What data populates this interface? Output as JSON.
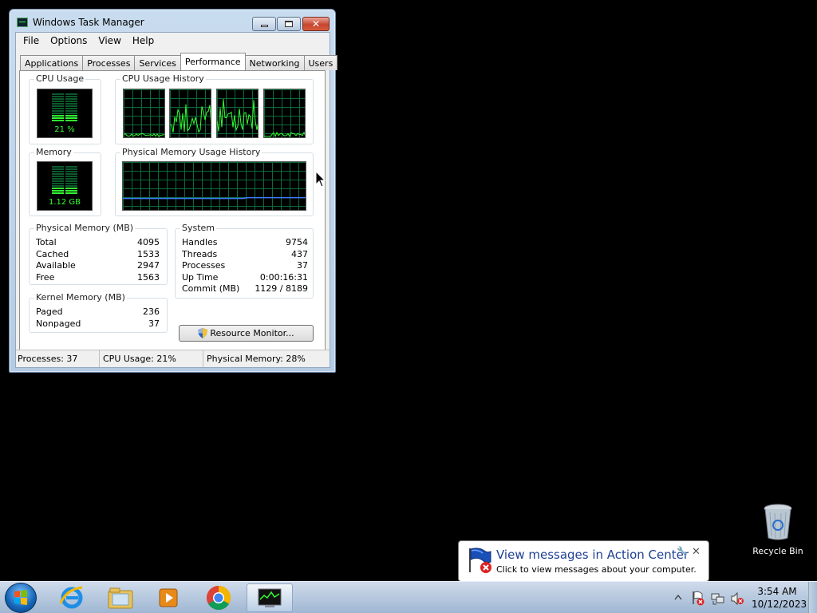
{
  "window": {
    "title": "Windows Task Manager",
    "controls": {
      "minimize": "minimize",
      "maximize": "maximize",
      "close": "✕"
    }
  },
  "menu": [
    "File",
    "Options",
    "View",
    "Help"
  ],
  "tabs": [
    "Applications",
    "Processes",
    "Services",
    "Performance",
    "Networking",
    "Users"
  ],
  "active_tab": "Performance",
  "performance": {
    "cpu_usage": {
      "label": "CPU Usage",
      "value": "21 %",
      "percent": 21
    },
    "cpu_history": {
      "label": "CPU Usage History",
      "cores": 4
    },
    "memory": {
      "label": "Memory",
      "value": "1.12 GB",
      "percent": 28
    },
    "memory_history": {
      "label": "Physical Memory Usage History"
    },
    "physical_memory": {
      "label": "Physical Memory (MB)",
      "rows": [
        {
          "k": "Total",
          "v": "4095"
        },
        {
          "k": "Cached",
          "v": "1533"
        },
        {
          "k": "Available",
          "v": "2947"
        },
        {
          "k": "Free",
          "v": "1563"
        }
      ]
    },
    "kernel_memory": {
      "label": "Kernel Memory (MB)",
      "rows": [
        {
          "k": "Paged",
          "v": "236"
        },
        {
          "k": "Nonpaged",
          "v": "37"
        }
      ]
    },
    "system": {
      "label": "System",
      "rows": [
        {
          "k": "Handles",
          "v": "9754"
        },
        {
          "k": "Threads",
          "v": "437"
        },
        {
          "k": "Processes",
          "v": "37"
        },
        {
          "k": "Up Time",
          "v": "0:00:16:31"
        },
        {
          "k": "Commit (MB)",
          "v": "1129 / 8189"
        }
      ]
    },
    "resource_monitor_button": "Resource Monitor..."
  },
  "statusbar": {
    "processes": "Processes: 37",
    "cpu": "CPU Usage: 21%",
    "memory": "Physical Memory: 28%"
  },
  "desktop": {
    "recycle_bin": "Recycle Bin"
  },
  "notification": {
    "title": "View messages in Action Center",
    "text": "Click to view messages about your computer."
  },
  "taskbar": {
    "apps": [
      "start-orb",
      "internet-explorer-icon",
      "windows-explorer-icon",
      "media-player-icon",
      "chrome-icon",
      "task-manager-icon"
    ],
    "clock": {
      "time": "3:54 AM",
      "date": "10/12/2023"
    }
  },
  "colors": {
    "graph_line": "#33ff33",
    "graph_grid": "#0b6b3a",
    "memory_line": "#3b7cff",
    "title_accent": "#1e3f93"
  }
}
